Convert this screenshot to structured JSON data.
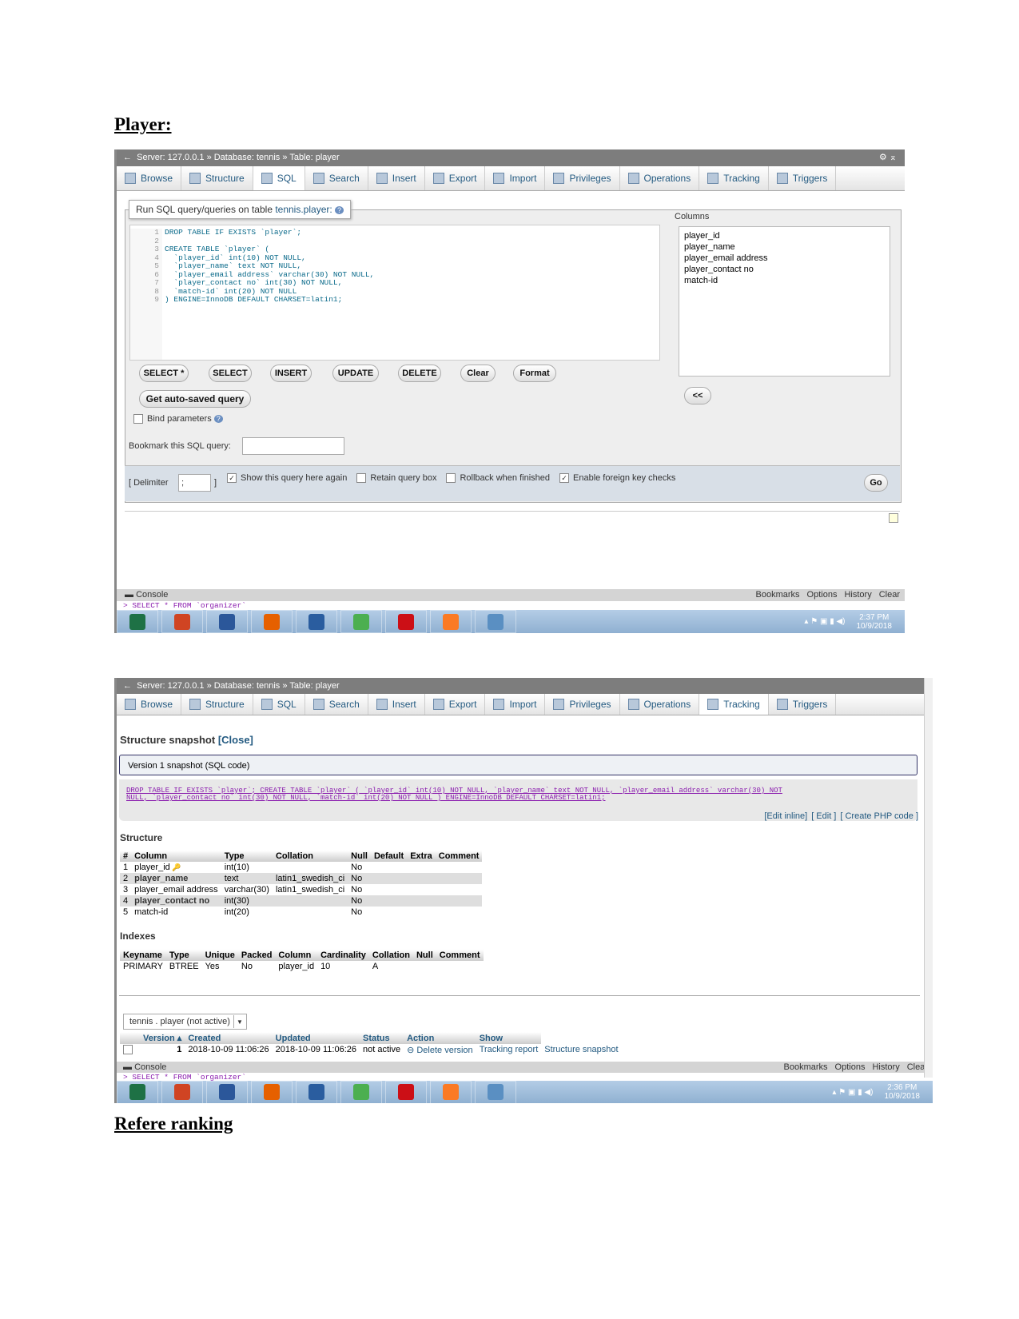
{
  "headings": {
    "player": "Player:",
    "next": "Refere ranking"
  },
  "shot1": {
    "breadcrumb": "Server: 127.0.0.1 » Database: tennis » Table: player",
    "tabs": [
      "Browse",
      "Structure",
      "SQL",
      "Search",
      "Insert",
      "Export",
      "Import",
      "Privileges",
      "Operations",
      "Tracking",
      "Triggers"
    ],
    "active_tab": "SQL",
    "legend_prefix": "Run SQL query/queries on table ",
    "legend_table": "tennis.player:",
    "line_numbers": [
      "1",
      "2",
      "3",
      "4",
      "5",
      "6",
      "7",
      "8",
      "9"
    ],
    "sql_lines": [
      "DROP TABLE IF EXISTS `player`;",
      "",
      "CREATE TABLE `player` (",
      "  `player_id` int(10) NOT NULL,",
      "  `player_name` text NOT NULL,",
      "  `player_email address` varchar(30) NOT NULL,",
      "  `player_contact no` int(30) NOT NULL,",
      "  `match-id` int(20) NOT NULL",
      ") ENGINE=InnoDB DEFAULT CHARSET=latin1;"
    ],
    "columns_label": "Columns",
    "columns": [
      "player_id",
      "player_name",
      "player_email address",
      "player_contact no",
      "match-id"
    ],
    "buttons": [
      "SELECT *",
      "SELECT",
      "INSERT",
      "UPDATE",
      "DELETE",
      "Clear",
      "Format"
    ],
    "insert_button": "<<",
    "autosaved": "Get auto-saved query",
    "bind_params": "Bind parameters",
    "bookmark_label": "Bookmark this SQL query:",
    "delimiter_label": "[ Delimiter",
    "delimiter_value": ";",
    "delimiter_close": "]",
    "options": [
      {
        "label": "Show this query here again",
        "checked": true
      },
      {
        "label": "Retain query box",
        "checked": false
      },
      {
        "label": "Rollback when finished",
        "checked": false
      },
      {
        "label": "Enable foreign key checks",
        "checked": true
      }
    ],
    "go": "Go",
    "console": {
      "label": "Console",
      "links": [
        "Bookmarks",
        "Options",
        "History",
        "Clear"
      ],
      "line": "> SELECT * FROM `organizer`"
    },
    "clock": {
      "time": "2:37 PM",
      "date": "10/9/2018"
    }
  },
  "shot2": {
    "breadcrumb": "Server: 127.0.0.1 » Database: tennis » Table: player",
    "tabs": [
      "Browse",
      "Structure",
      "SQL",
      "Search",
      "Insert",
      "Export",
      "Import",
      "Privileges",
      "Operations",
      "Tracking",
      "Triggers"
    ],
    "active_tab": "Tracking",
    "snapshot_title": "Structure snapshot",
    "close_link": "[Close]",
    "version_legend": "Version 1 snapshot (SQL code)",
    "sql": "DROP TABLE IF EXISTS `player`; CREATE TABLE `player` ( `player_id` int(10) NOT NULL, `player_name` text NOT NULL, `player_email address` varchar(30) NOT\nNULL, `player_contact no` int(30) NOT NULL, `match-id` int(20) NOT NULL ) ENGINE=InnoDB DEFAULT CHARSET=latin1;",
    "edit_links": [
      "[Edit inline]",
      "[ Edit ]",
      "[ Create PHP code ]"
    ],
    "structure_title": "Structure",
    "structure_headers": [
      "#",
      "Column",
      "Type",
      "Collation",
      "Null",
      "Default",
      "Extra",
      "Comment"
    ],
    "structure_rows": [
      [
        "1",
        "player_id",
        "int(10)",
        "",
        "No",
        "",
        "",
        ""
      ],
      [
        "2",
        "player_name",
        "text",
        "latin1_swedish_ci",
        "No",
        "",
        "",
        ""
      ],
      [
        "3",
        "player_email address",
        "varchar(30)",
        "latin1_swedish_ci",
        "No",
        "",
        "",
        ""
      ],
      [
        "4",
        "player_contact no",
        "int(30)",
        "",
        "No",
        "",
        "",
        ""
      ],
      [
        "5",
        "match-id",
        "int(20)",
        "",
        "No",
        "",
        "",
        ""
      ]
    ],
    "indexes_title": "Indexes",
    "index_headers": [
      "Keyname",
      "Type",
      "Unique",
      "Packed",
      "Column",
      "Cardinality",
      "Collation",
      "Null",
      "Comment"
    ],
    "index_rows": [
      [
        "PRIMARY",
        "BTREE",
        "Yes",
        "No",
        "player_id",
        "10",
        "A",
        "",
        ""
      ]
    ],
    "table_select": "tennis . player (not active)",
    "version_headers": [
      "",
      "Version ▴",
      "Created",
      "Updated",
      "Status",
      "Action",
      "Show"
    ],
    "version_rows": [
      [
        "",
        "1",
        "2018-10-09 11:06:26",
        "2018-10-09 11:06:26",
        "not active",
        "Delete version",
        "Tracking report",
        "Structure snapshot"
      ]
    ],
    "console": {
      "label": "Console",
      "links": [
        "Bookmarks",
        "Options",
        "History",
        "Clear"
      ],
      "line": "> SELECT * FROM `organizer`"
    },
    "clock": {
      "time": "2:36 PM",
      "date": "10/9/2018"
    }
  },
  "taskbar_apps": [
    {
      "name": "excel",
      "color": "#1e7145"
    },
    {
      "name": "powerpoint",
      "color": "#d04423"
    },
    {
      "name": "word",
      "color": "#2b579a"
    },
    {
      "name": "firefox",
      "color": "#e66000"
    },
    {
      "name": "thunderbird",
      "color": "#2a5d9f"
    },
    {
      "name": "chrome",
      "color": "#4caf50"
    },
    {
      "name": "opera",
      "color": "#cc0f16"
    },
    {
      "name": "xampp",
      "color": "#fb7a24"
    },
    {
      "name": "photos",
      "color": "#5a8fc2"
    }
  ]
}
